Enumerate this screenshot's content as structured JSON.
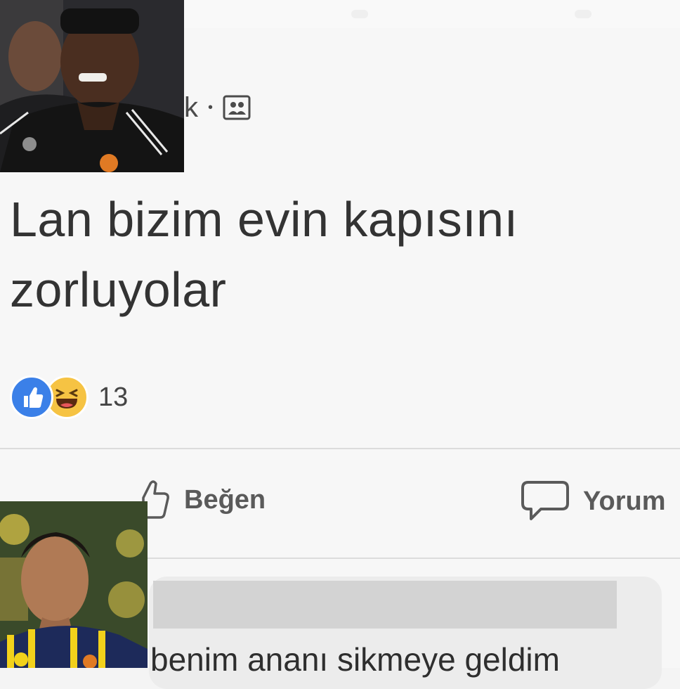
{
  "post": {
    "meta_time_fragment": "k",
    "meta_separator": "•",
    "audience_icon": "friends-icon",
    "text_line1": "Lan bizim evin kapısını",
    "text_line2": "zorluyolar",
    "reactions": {
      "icons": [
        "like-reaction-icon",
        "haha-reaction-icon"
      ],
      "count": "13"
    },
    "actions": {
      "like_label": "Beğen",
      "comment_label": "Yorum"
    }
  },
  "comment": {
    "text": "benim ananı sikmeye geldim"
  },
  "colors": {
    "like_blue": "#3b80e8",
    "haha_yellow": "#f6c343",
    "jersey_black": "#141414",
    "jersey_navy": "#1d2a5a",
    "jersey_yellow": "#f2d11b"
  }
}
